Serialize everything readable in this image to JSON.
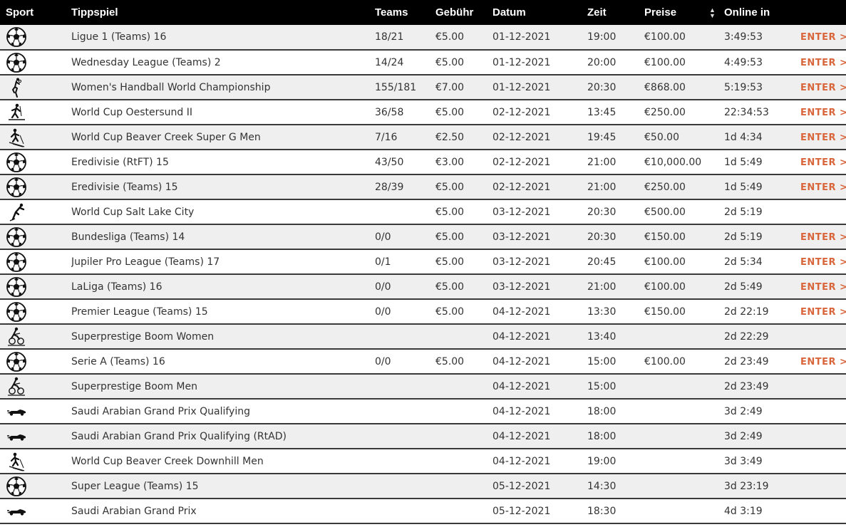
{
  "columns": {
    "sport": "Sport",
    "name": "Tippspiel",
    "teams": "Teams",
    "fee": "Gebühr",
    "date": "Datum",
    "time": "Zeit",
    "prize": "Preise",
    "online": "Online in"
  },
  "rows": [
    {
      "sport_icon": "soccer-ball-icon",
      "name": "Ligue 1 (Teams) 16",
      "teams": "18/21",
      "fee": "€5.00",
      "date": "01-12-2021",
      "time": "19:00",
      "prize": "€100.00",
      "online": "3:49:53",
      "enter": "ENTER >"
    },
    {
      "sport_icon": "soccer-ball-icon",
      "name": "Wednesday League (Teams) 2",
      "teams": "14/24",
      "fee": "€5.00",
      "date": "01-12-2021",
      "time": "20:00",
      "prize": "€100.00",
      "online": "4:49:53",
      "enter": "ENTER >"
    },
    {
      "sport_icon": "handball-icon",
      "name": "Women's Handball World Championship",
      "teams": "155/181",
      "fee": "€7.00",
      "date": "01-12-2021",
      "time": "20:30",
      "prize": "€868.00",
      "online": "5:19:53",
      "enter": "ENTER >"
    },
    {
      "sport_icon": "biathlon-icon",
      "name": "World Cup Oestersund II",
      "teams": "36/58",
      "fee": "€5.00",
      "date": "02-12-2021",
      "time": "13:45",
      "prize": "€250.00",
      "online": "22:34:53",
      "enter": "ENTER >"
    },
    {
      "sport_icon": "alpine-skiing-icon",
      "name": "World Cup Beaver Creek Super G Men",
      "teams": "7/16",
      "fee": "€2.50",
      "date": "02-12-2021",
      "time": "19:45",
      "prize": "€50.00",
      "online": "1d 4:34",
      "enter": "ENTER >"
    },
    {
      "sport_icon": "soccer-ball-icon",
      "name": "Eredivisie (RtFT) 15",
      "teams": "43/50",
      "fee": "€3.00",
      "date": "02-12-2021",
      "time": "21:00",
      "prize": "€10,000.00",
      "online": "1d 5:49",
      "enter": "ENTER >"
    },
    {
      "sport_icon": "soccer-ball-icon",
      "name": "Eredivisie (Teams) 15",
      "teams": "28/39",
      "fee": "€5.00",
      "date": "02-12-2021",
      "time": "21:00",
      "prize": "€250.00",
      "online": "1d 5:49",
      "enter": "ENTER >"
    },
    {
      "sport_icon": "speed-skating-icon",
      "name": "World Cup Salt Lake City",
      "teams": "",
      "fee": "€5.00",
      "date": "03-12-2021",
      "time": "20:30",
      "prize": "€500.00",
      "online": "2d 5:19",
      "enter": ""
    },
    {
      "sport_icon": "soccer-ball-icon",
      "name": "Bundesliga (Teams) 14",
      "teams": "0/0",
      "fee": "€5.00",
      "date": "03-12-2021",
      "time": "20:30",
      "prize": "€150.00",
      "online": "2d 5:19",
      "enter": "ENTER >"
    },
    {
      "sport_icon": "soccer-ball-icon",
      "name": "Jupiler Pro League (Teams) 17",
      "teams": "0/1",
      "fee": "€5.00",
      "date": "03-12-2021",
      "time": "20:45",
      "prize": "€100.00",
      "online": "2d 5:34",
      "enter": "ENTER >"
    },
    {
      "sport_icon": "soccer-ball-icon",
      "name": "LaLiga (Teams) 16",
      "teams": "0/0",
      "fee": "€5.00",
      "date": "03-12-2021",
      "time": "21:00",
      "prize": "€100.00",
      "online": "2d 5:49",
      "enter": "ENTER >"
    },
    {
      "sport_icon": "soccer-ball-icon",
      "name": "Premier League (Teams) 15",
      "teams": "0/0",
      "fee": "€5.00",
      "date": "04-12-2021",
      "time": "13:30",
      "prize": "€150.00",
      "online": "2d 22:19",
      "enter": "ENTER >"
    },
    {
      "sport_icon": "cyclocross-icon",
      "name": "Superprestige Boom Women",
      "teams": "",
      "fee": "",
      "date": "04-12-2021",
      "time": "13:40",
      "prize": "",
      "online": "2d 22:29",
      "enter": ""
    },
    {
      "sport_icon": "soccer-ball-icon",
      "name": "Serie A (Teams) 16",
      "teams": "0/0",
      "fee": "€5.00",
      "date": "04-12-2021",
      "time": "15:00",
      "prize": "€100.00",
      "online": "2d 23:49",
      "enter": "ENTER >"
    },
    {
      "sport_icon": "cyclocross-icon",
      "name": "Superprestige Boom Men",
      "teams": "",
      "fee": "",
      "date": "04-12-2021",
      "time": "15:00",
      "prize": "",
      "online": "2d 23:49",
      "enter": ""
    },
    {
      "sport_icon": "formula1-car-icon",
      "name": "Saudi Arabian Grand Prix Qualifying",
      "teams": "",
      "fee": "",
      "date": "04-12-2021",
      "time": "18:00",
      "prize": "",
      "online": "3d 2:49",
      "enter": ""
    },
    {
      "sport_icon": "formula1-car-icon",
      "name": "Saudi Arabian Grand Prix Qualifying (RtAD)",
      "teams": "",
      "fee": "",
      "date": "04-12-2021",
      "time": "18:00",
      "prize": "",
      "online": "3d 2:49",
      "enter": ""
    },
    {
      "sport_icon": "alpine-skiing-icon",
      "name": "World Cup Beaver Creek Downhill Men",
      "teams": "",
      "fee": "",
      "date": "04-12-2021",
      "time": "19:00",
      "prize": "",
      "online": "3d 3:49",
      "enter": ""
    },
    {
      "sport_icon": "soccer-ball-icon",
      "name": "Super League (Teams) 15",
      "teams": "",
      "fee": "",
      "date": "05-12-2021",
      "time": "14:30",
      "prize": "",
      "online": "3d 23:19",
      "enter": ""
    },
    {
      "sport_icon": "formula1-car-icon",
      "name": "Saudi Arabian Grand Prix",
      "teams": "",
      "fee": "",
      "date": "05-12-2021",
      "time": "18:30",
      "prize": "",
      "online": "4d 3:19",
      "enter": ""
    }
  ],
  "colors": {
    "header_bg": "#000000",
    "header_text": "#ffffff",
    "row_alt_bg": "#efefef",
    "enter_accent": "#d9653b",
    "divider": "#3a3a3a"
  }
}
